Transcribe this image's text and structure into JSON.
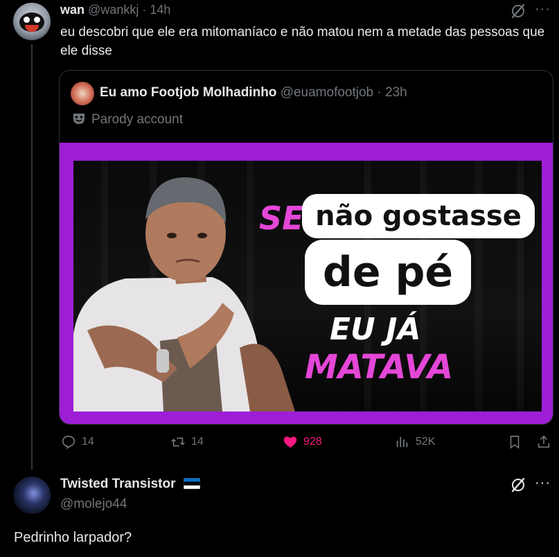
{
  "tweet": {
    "author_name": "wan",
    "author_handle": "@wankkj",
    "separator": "·",
    "time": "14h",
    "more": "···",
    "text": "eu descobri que ele era mitomaníaco e não matou nem a metade das pessoas que ele disse",
    "quote": {
      "author_name": "Eu amo Footjob Molhadinho",
      "author_handle": "@euamofootjob",
      "separator": "·",
      "time": "23h",
      "parody_label": "Parody account",
      "media_text": {
        "line1_prefix": "SE",
        "line1": "não gostasse",
        "line2": "de pé",
        "line3": "EU JÁ",
        "line4": "MATAVA"
      }
    },
    "stats": {
      "replies": "14",
      "reposts": "14",
      "likes": "928",
      "views": "52K"
    }
  },
  "reply": {
    "author_name": "Twisted Transistor",
    "author_handle": "@molejo44",
    "more": "···",
    "text": "Pedrinho larpador?"
  },
  "colors": {
    "background": "#000000",
    "text": "#e7e9ea",
    "muted": "#71767b",
    "like_pink": "#f91880",
    "media_purple": "#9e1ed6",
    "media_magenta": "#e447d8"
  },
  "icons": [
    "grok-icon",
    "more-icon",
    "mask-icon",
    "reply-icon",
    "repost-icon",
    "like-icon",
    "views-icon",
    "bookmark-icon",
    "share-icon",
    "estonia-flag-icon"
  ]
}
